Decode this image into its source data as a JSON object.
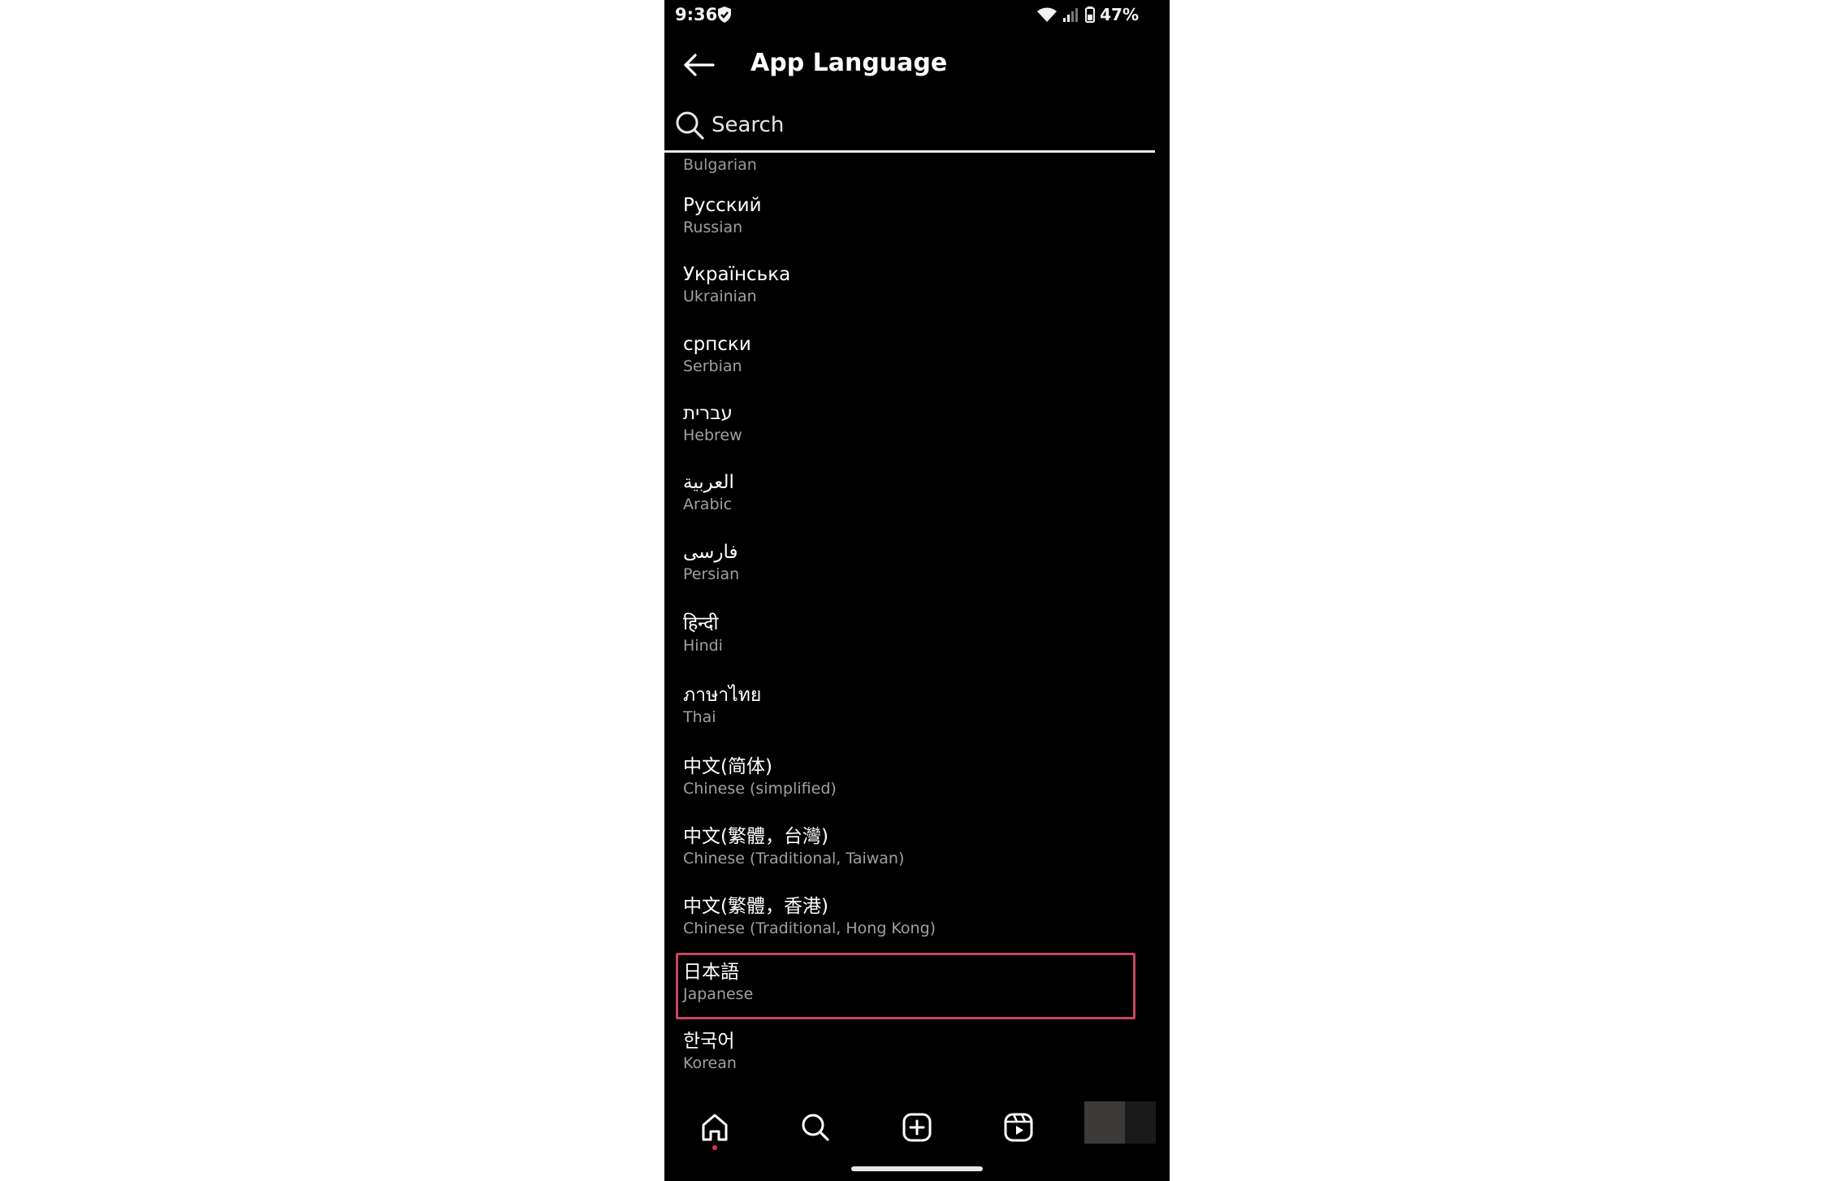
{
  "status_bar": {
    "time": "9:36",
    "battery": "47%"
  },
  "header": {
    "title": "App Language"
  },
  "search": {
    "placeholder": "Search"
  },
  "partial_item": {
    "english": "Bulgarian"
  },
  "languages": [
    {
      "native": "Русский",
      "english": "Russian"
    },
    {
      "native": "Українська",
      "english": "Ukrainian"
    },
    {
      "native": "српски",
      "english": "Serbian"
    },
    {
      "native": "עברית",
      "english": "Hebrew"
    },
    {
      "native": "العربية",
      "english": "Arabic"
    },
    {
      "native": "فارسی",
      "english": "Persian"
    },
    {
      "native": "हिन्दी",
      "english": "Hindi"
    },
    {
      "native": "ภาษาไทย",
      "english": "Thai"
    },
    {
      "native": "中文(简体)",
      "english": "Chinese (simplified)"
    },
    {
      "native": "中文(繁體，台灣)",
      "english": "Chinese (Traditional, Taiwan)"
    },
    {
      "native": "中文(繁體，香港)",
      "english": "Chinese (Traditional, Hong Kong)"
    },
    {
      "native": "日本語",
      "english": "Japanese",
      "selected": true
    },
    {
      "native": "한국어",
      "english": "Korean"
    }
  ],
  "bottom_nav": {
    "items": [
      "home-icon",
      "search-icon",
      "create-icon",
      "reels-icon",
      "profile-avatar"
    ]
  },
  "colors": {
    "background": "#000000",
    "selection_border": "#c8455e",
    "notification_dot": "#e0324f",
    "secondary_text": "#a0a0a0"
  }
}
